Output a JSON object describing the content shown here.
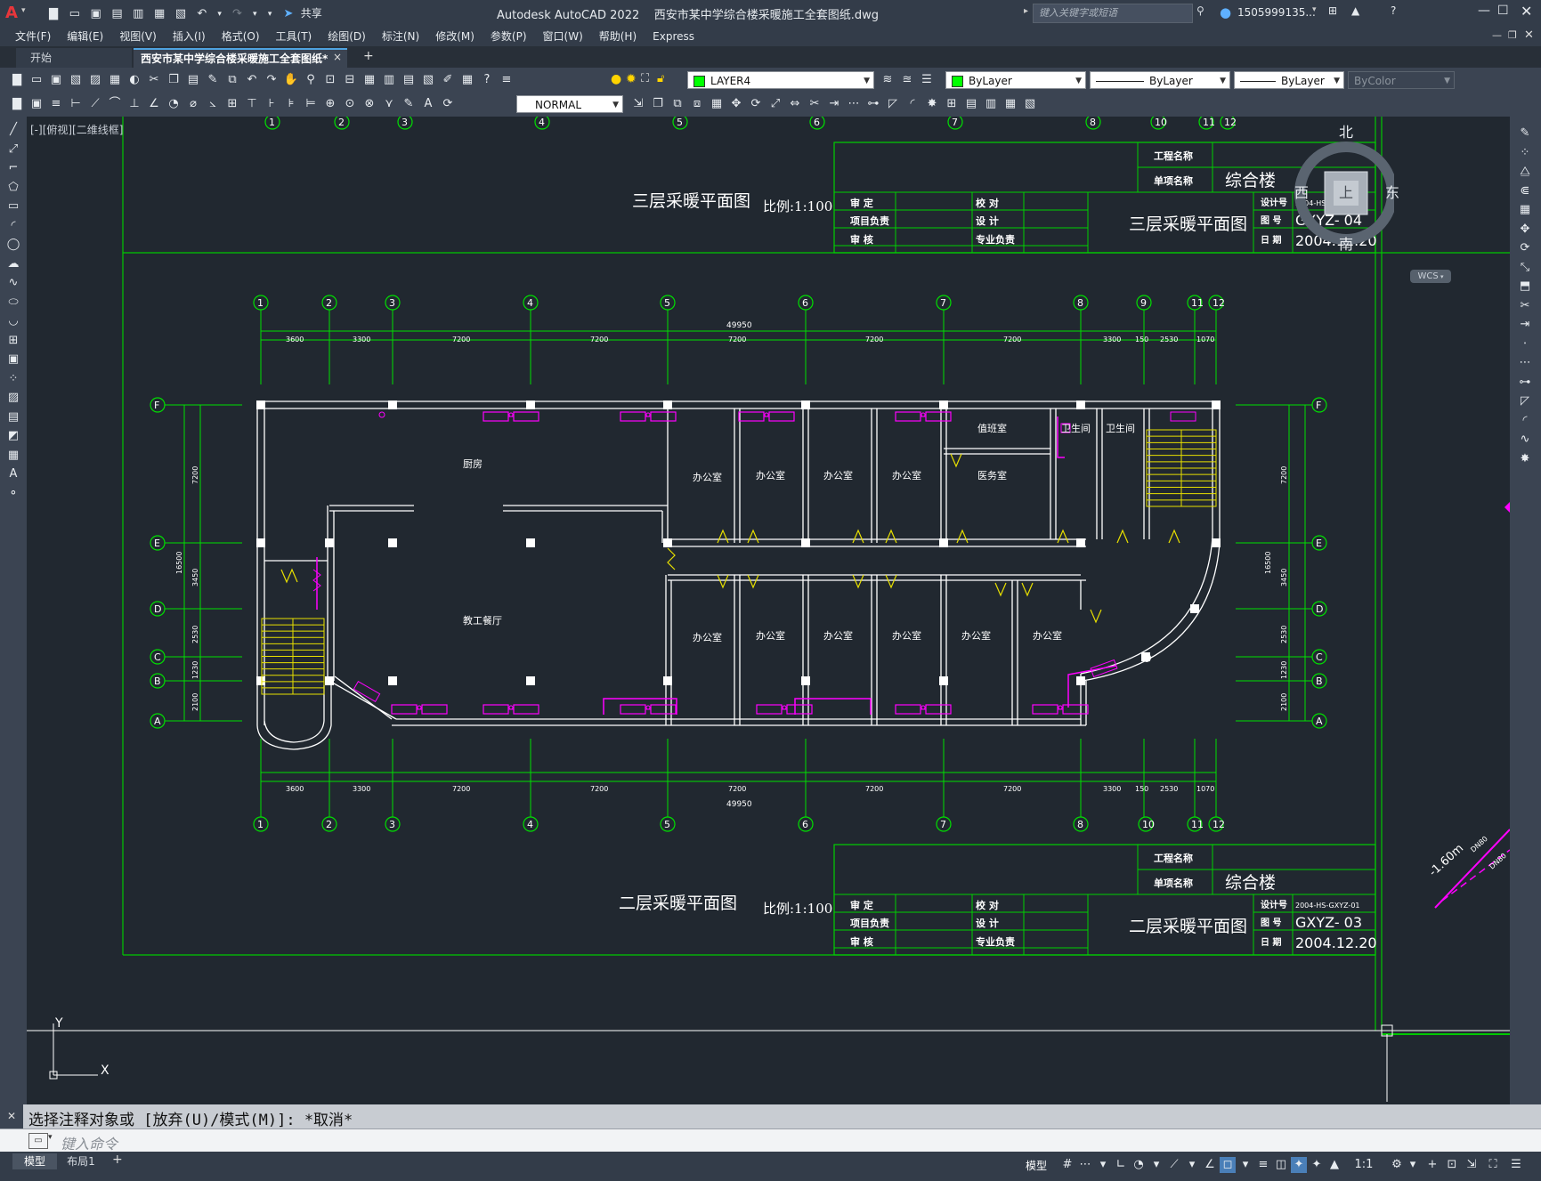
{
  "app": {
    "title": "Autodesk AutoCAD 2022    西安市某中学综合楼采暖施工全套图纸.dwg",
    "logo_letter": "A",
    "share_label": "共享",
    "search_placeholder": "键入关键字或短语",
    "user": "1505999135...",
    "window_controls": [
      "minimize-icon",
      "maximize-icon",
      "close-icon"
    ]
  },
  "menu": {
    "items": [
      "文件(F)",
      "编辑(E)",
      "视图(V)",
      "插入(I)",
      "格式(O)",
      "工具(T)",
      "绘图(D)",
      "标注(N)",
      "修改(M)",
      "参数(P)",
      "窗口(W)",
      "帮助(H)",
      "Express"
    ]
  },
  "tabs": {
    "start": "开始",
    "active": "西安市某中学综合楼采暖施工全套图纸*",
    "close": "×",
    "add": "+"
  },
  "toolbar": {
    "layer": "LAYER4",
    "color": "ByLayer",
    "linetype": "ByLayer",
    "lineweight": "ByLayer",
    "plotstyle": "ByColor",
    "style": "NORMAL",
    "layer_color": "#00ff00"
  },
  "viewport": {
    "label": "[-][俯视][二维线框]",
    "compass": {
      "north": "北",
      "south": "南",
      "east": "东",
      "west": "西",
      "top": "上"
    },
    "wcs": "WCS",
    "ucs_x": "X",
    "ucs_y": "Y"
  },
  "drawing": {
    "plan3_title": "三层采暖平面图",
    "plan2_title": "二层采暖平面图",
    "scale": "比例:1:100",
    "grid_numbers_top": [
      "1",
      "2",
      "3",
      "4",
      "5",
      "6",
      "7",
      "8",
      "10",
      "11",
      "12"
    ],
    "grid_numbers_mid": [
      "1",
      "2",
      "3",
      "4",
      "5",
      "6",
      "7",
      "8",
      "9",
      "11",
      "12"
    ],
    "grid_numbers_bottom": [
      "1",
      "2",
      "3",
      "4",
      "5",
      "6",
      "7",
      "8",
      "10",
      "11",
      "12"
    ],
    "grid_letters": [
      "F",
      "E",
      "D",
      "C",
      "B",
      "A"
    ],
    "dims_top": [
      "3600",
      "3300",
      "7200",
      "7200",
      "7200",
      "7200",
      "7200",
      "3300",
      "150",
      "2530",
      "1070"
    ],
    "dims_total": "49950",
    "dims_left": [
      "7200",
      "3450",
      "2530",
      "1230",
      "2100"
    ],
    "dims_left_total": "16500",
    "rooms": {
      "kitchen": "厨房",
      "dining": "教工餐厅",
      "office": "办公室",
      "duty": "值班室",
      "clinic": "医务室",
      "toilet": "卫生间"
    },
    "title_block": {
      "project_label": "工程名称",
      "item_label": "单项名称",
      "item_value": "综合楼",
      "approve": "审  定",
      "check": "校  对",
      "lead": "项目负责",
      "design": "设  计",
      "review": "审  核",
      "specialist": "专业负责",
      "design_no_label": "设计号",
      "design_no": "2004-HS-GXYZ-01",
      "drawing_no_label": "图  号",
      "date_label": "日  期",
      "date": "2004.12.20",
      "sheet3_no": "GXYZ- 04",
      "sheet2_no": "GXYZ- 03"
    },
    "pipe_label": "-1.60m",
    "pipe_dn1": "DN80",
    "pipe_dn2": "DN80"
  },
  "command": {
    "history": "选择注释对象或 [放弃(U)/模式(M)]: *取消*",
    "placeholder": "键入命令"
  },
  "status": {
    "model_tab": "模型",
    "layout_tab": "布局1",
    "add": "+",
    "model_button": "模型",
    "scale": "1:1"
  }
}
